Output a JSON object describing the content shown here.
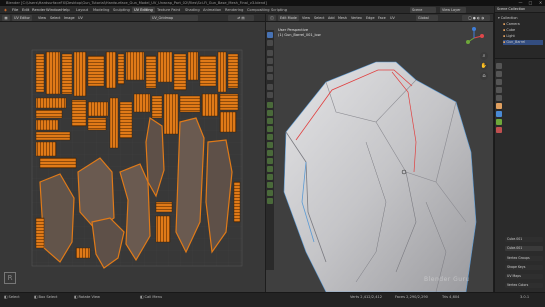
{
  "window": {
    "title": "Blender [C:\\Users\\HardsurfaceFX\\Desktop\\Gun_Tutorial\\Hardsurface_Gun_Model_UV_Unwrap_Part_02\\Files\\Sci-Fi_Gun_Base_Mesh_Final_v3.blend]",
    "controls": [
      "—",
      "□",
      "✕"
    ]
  },
  "menubar": {
    "menus": [
      "File",
      "Edit",
      "Render",
      "Window",
      "Help"
    ],
    "workspaces": [
      "Layout",
      "Modeling",
      "Sculpting",
      "UV Editing",
      "Texture Paint",
      "Shading",
      "Animation",
      "Rendering",
      "Compositing",
      "Scripting"
    ],
    "active_workspace": "UV Editing",
    "scene_label": "Scene",
    "view_layer_label": "View Layer"
  },
  "uv_editor": {
    "mode_label": "UV Editor",
    "view_menu": "View",
    "select_menu": "Select",
    "image_menu": "Image",
    "uv_menu": "UV",
    "image_name": "UV_Gridmap",
    "colors": {
      "island": "#e07a18",
      "island_edge": "#3a1c00",
      "grid": "#444444"
    }
  },
  "viewport": {
    "mode_label": "Edit Mode",
    "view_menu": "View",
    "select_menu": "Select",
    "add_menu": "Add",
    "mesh_menu": "Mesh",
    "vertex_menu": "Vertex",
    "edge_menu": "Edge",
    "face_menu": "Face",
    "uv_menu": "UV",
    "shading_label": "Global",
    "view_name": "User Perspective",
    "object_name": "(1) Gun_Barrel_001_low",
    "watermark": "Blender Guru",
    "colors": {
      "mesh": "#c9c9cc",
      "seam": "#e04040",
      "edge": "#5a9ad5"
    }
  },
  "outliner": {
    "header": "Scene Collection",
    "items": [
      "Collection",
      "Camera",
      "Cube",
      "Light",
      "Gun_Barrel"
    ]
  },
  "properties": {
    "object_name": "Cube.001",
    "rows": [
      "Cube.001",
      "Vertex Groups",
      "Shape Keys",
      "UV Maps",
      "Vertex Colors"
    ]
  },
  "statusbar": {
    "items": [
      "Select",
      "Box Select",
      "Rotate View",
      "Call Menu"
    ],
    "right_items": [
      "Verts 2,412/2,412",
      "Faces 2,290/2,290",
      "Tris 4,604",
      "3.0.1"
    ]
  }
}
